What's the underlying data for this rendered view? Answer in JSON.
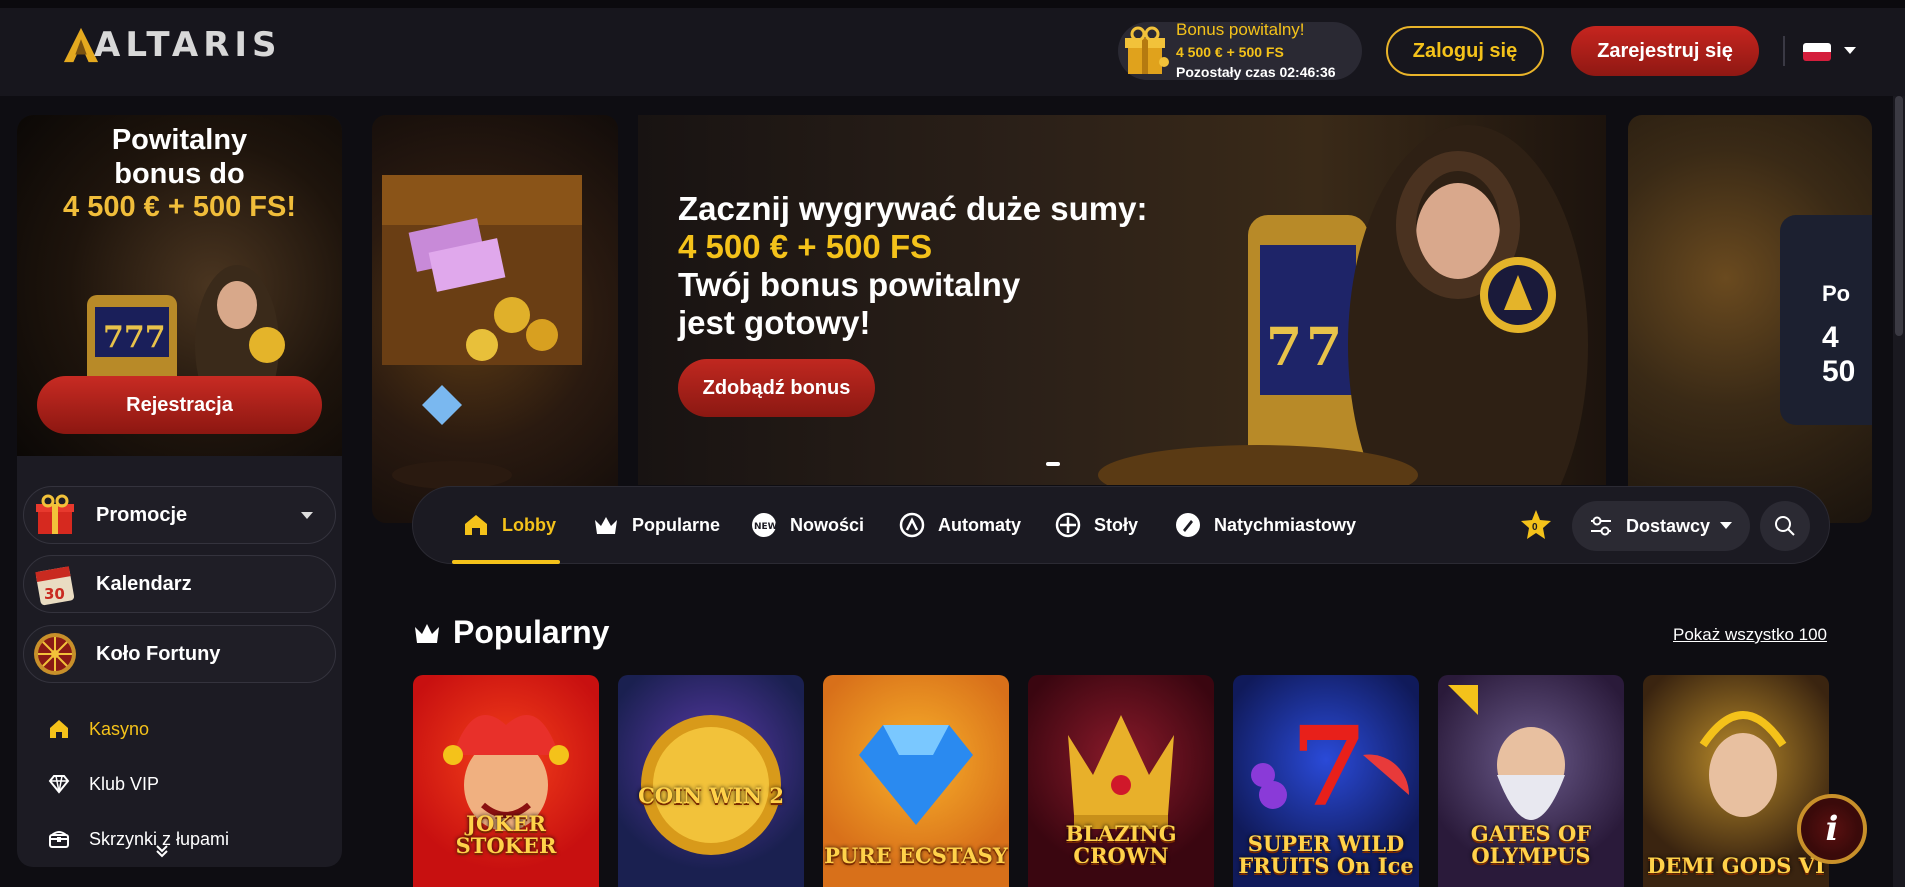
{
  "header": {
    "logo_text": "ALTARIS",
    "bonus_title": "Bonus powitalny!",
    "bonus_amount": "4 500 € + 500 FS",
    "bonus_timer": "Pozostały czas 02:46:36",
    "login_label": "Zaloguj się",
    "register_label": "Zarejestruj się",
    "language_flag": "PL"
  },
  "sidebar": {
    "promo_title": "Powitalny bonus do",
    "promo_amount": "4 500 € + 500 FS!",
    "promo_button": "Rejestracja",
    "items": [
      {
        "label": "Promocje",
        "icon": "gift-icon"
      },
      {
        "label": "Kalendarz",
        "icon": "calendar-icon"
      },
      {
        "label": "Koło Fortuny",
        "icon": "wheel-icon"
      }
    ],
    "links": [
      {
        "label": "Kasyno",
        "icon": "home-icon"
      },
      {
        "label": "Klub VIP",
        "icon": "diamond-icon"
      },
      {
        "label": "Skrzynki z łupami",
        "icon": "chest-icon"
      }
    ]
  },
  "hero": {
    "line1": "Zacznij wygrywać duże sumy:",
    "line2": "4 500 € + 500 FS",
    "line3": "Twój bonus powitalny",
    "line4": "jest gotowy!",
    "button": "Zdobądź bonus",
    "right_card_a": "Po",
    "right_card_b": "4 50"
  },
  "tabs": [
    {
      "label": "Lobby",
      "icon": "home-icon"
    },
    {
      "label": "Popularne",
      "icon": "crown-icon"
    },
    {
      "label": "Nowości",
      "icon": "new-badge-icon"
    },
    {
      "label": "Automaty",
      "icon": "slot-icon"
    },
    {
      "label": "Stoły",
      "icon": "chip-icon"
    },
    {
      "label": "Natychmiastowy",
      "icon": "rocket-icon"
    }
  ],
  "favorites_count": "0",
  "providers_label": "Dostawcy",
  "popular": {
    "title": "Popularny",
    "show_all": "Pokaż wszystko 100",
    "games": [
      {
        "name": "JOKER STOKER",
        "color": "#d81b1b"
      },
      {
        "name": "COIN WIN 2",
        "color": "#2a3a8a"
      },
      {
        "name": "PURE ECSTASY",
        "color": "#e8901a"
      },
      {
        "name": "BLAZING CROWN",
        "color": "#5a0a14"
      },
      {
        "name": "SUPER WILD FRUITS On Ice",
        "color": "#1a2a8a"
      },
      {
        "name": "GATES OF OLYMPUS",
        "color": "#3a2a5a"
      },
      {
        "name": "DEMI GODS VI",
        "color": "#6a4a18"
      }
    ]
  },
  "info_label": "i"
}
